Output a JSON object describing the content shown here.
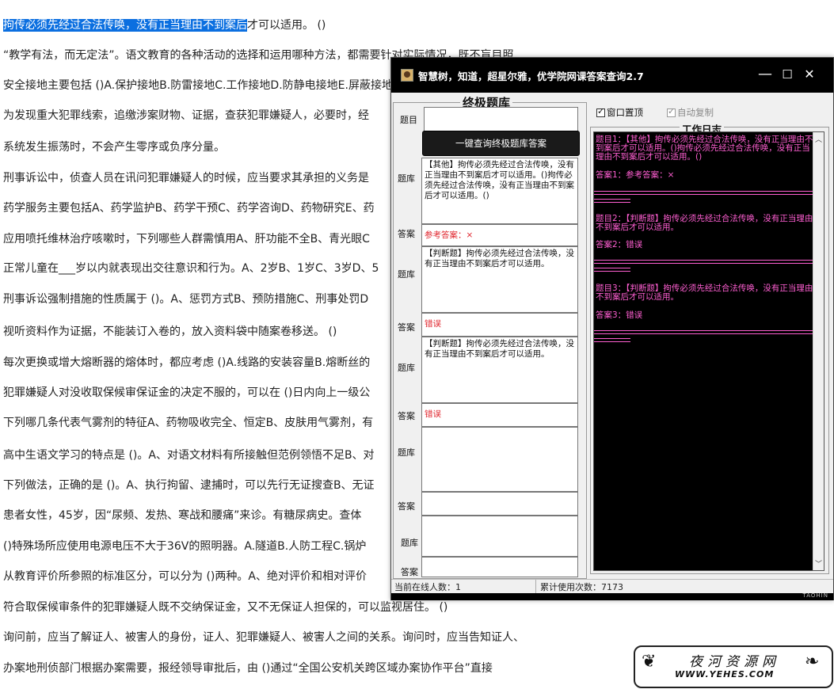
{
  "document": {
    "lines": [
      {
        "pre": "拘传必须先经过合法传唤，没有正当理由不到案后",
        "post": "才可以适用。  ()"
      },
      {
        "pre": "",
        "post": "“教学有法，而无定法”。语文教育的各种活动的选择和运用哪种方法，都需要针对实际情况，既不盲目照"
      },
      {
        "pre": "",
        "post": "安全接地主要包括  ()A.保护接地B.防雷接地C.工作接地D.防静电接地E.屏蔽接地"
      },
      {
        "pre": "",
        "post": "为发现重大犯罪线索，追缴涉案财物、证据，查获犯罪嫌疑人，必要时，经"
      },
      {
        "pre": "",
        "post": "系统发生振荡时，不会产生零序或负序分量。"
      },
      {
        "pre": "",
        "post": "刑事诉讼中，侦查人员在讯问犯罪嫌疑人的时候，应当要求其承担的义务是"
      },
      {
        "pre": "",
        "post": "药学服务主要包括A、药学监护B、药学干预C、药学咨询D、药物研究E、药"
      },
      {
        "pre": "",
        "post": "应用喷托维林治疗咳嗽时，下列哪些人群需慎用A、肝功能不全B、青光眼C"
      },
      {
        "pre": "",
        "post": "正常儿童在___岁以内就表现出交往意识和行为。A、2岁B、1岁C、3岁D、5"
      },
      {
        "pre": "",
        "post": "刑事诉讼强制措施的性质属于 ()。A、惩罚方式B、预防措施C、刑事处罚D"
      },
      {
        "pre": "",
        "post": "视听资料作为证据，不能装订入卷的，放入资料袋中随案卷移送。 ()"
      },
      {
        "pre": "",
        "post": "每次更换或增大熔断器的熔体时，都应考虑  ()A.线路的安装容量B.熔断丝的"
      },
      {
        "pre": "",
        "post": "犯罪嫌疑人对没收取保候审保证金的决定不服的，可以在  ()日内向上一级公"
      },
      {
        "pre": "",
        "post": "下列哪几条代表气雾剂的特征A、药物吸收完全、恒定B、皮肤用气雾剂，有"
      },
      {
        "pre": "",
        "post": "高中生语文学习的特点是 ()。A、对语文材料有所接触但范例领悟不足B、对"
      },
      {
        "pre": "",
        "post": "下列做法，正确的是 ()。A、执行拘留、逮捕时，可以先行无证搜查B、无证"
      },
      {
        "pre": "",
        "post": "患者女性，45岁，因“尿频、发热、寒战和腰痛”来诊。有糖尿病史。查体"
      },
      {
        "pre": "",
        "post": "  ()特殊场所应使用电源电压不大于36V的照明器。A.隧道B.人防工程C.锅炉"
      },
      {
        "pre": "",
        "post": "从教育评价所参照的标准区分，可以分为 ()两种。A、绝对评价和相对评价"
      },
      {
        "pre": "",
        "post": "符合取保候审条件的犯罪嫌疑人既不交纳保证金，又不无保证人担保的，可以监视居住。 ()"
      },
      {
        "pre": "",
        "post": "询问前，应当了解证人、被害人的身份，证人、犯罪嫌疑人、被害人之间的关系。询问时，应当告知证人、"
      },
      {
        "pre": "",
        "post": "办案地刑侦部门根据办案需要，报经领导审批后，由 ()通过“全国公安机关跨区域办案协作平台”直接"
      }
    ]
  },
  "watermark": {
    "title": "夜河资源网",
    "url": "WWW.YEHES.COM"
  },
  "window": {
    "title": "智慧树，知道，超星尔雅，优学院网课答案查询2.7",
    "minimize": "—",
    "maximize": "☐",
    "close": "✕",
    "left_group_title": "终极题库",
    "question_label": "题目",
    "question_value": "",
    "query_button": "一键查询终极题库答案",
    "bank_label": "题库",
    "answer_label": "答案",
    "entries": [
      {
        "bank": "【其他】拘传必须先经过合法传唤，没有正当理由不到案后才可以适用。()拘传必须先经过合法传唤，没有正当理由不到案后才可以适用。()",
        "answer": "参考答案：×"
      },
      {
        "bank": "【判断题】拘传必须先经过合法传唤，没有正当理由不到案后才可以适用。",
        "answer": "错误"
      },
      {
        "bank": "【判断题】拘传必须先经过合法传唤，没有正当理由不到案后才可以适用。",
        "answer": "错误"
      },
      {
        "bank": "",
        "answer": ""
      },
      {
        "bank": "",
        "answer": ""
      }
    ],
    "checkbox_top": {
      "label": "窗口置顶",
      "checked": true
    },
    "checkbox_copy": {
      "label": "自动复制",
      "checked": true
    },
    "log_title": "工作日志",
    "log": [
      {
        "q": "题目1：【其他】拘传必须先经过合法传唤，没有正当理由不到案后才可以适用。()拘传必须先经过合法传唤，没有正当理由不到案后才可以适用。()",
        "a": "答案1：参考答案：×"
      },
      {
        "q": "题目2：【判断题】拘传必须先经过合法传唤，没有正当理由不到案后才可以适用。",
        "a": "答案2：错误"
      },
      {
        "q": "题目3：【判断题】拘传必须先经过合法传唤，没有正当理由不到案后才可以适用。",
        "a": "答案3：错误"
      }
    ],
    "status_online": "当前在线人数：1",
    "status_usage": "累计使用次数：7173",
    "brand": "TAOHIN"
  }
}
